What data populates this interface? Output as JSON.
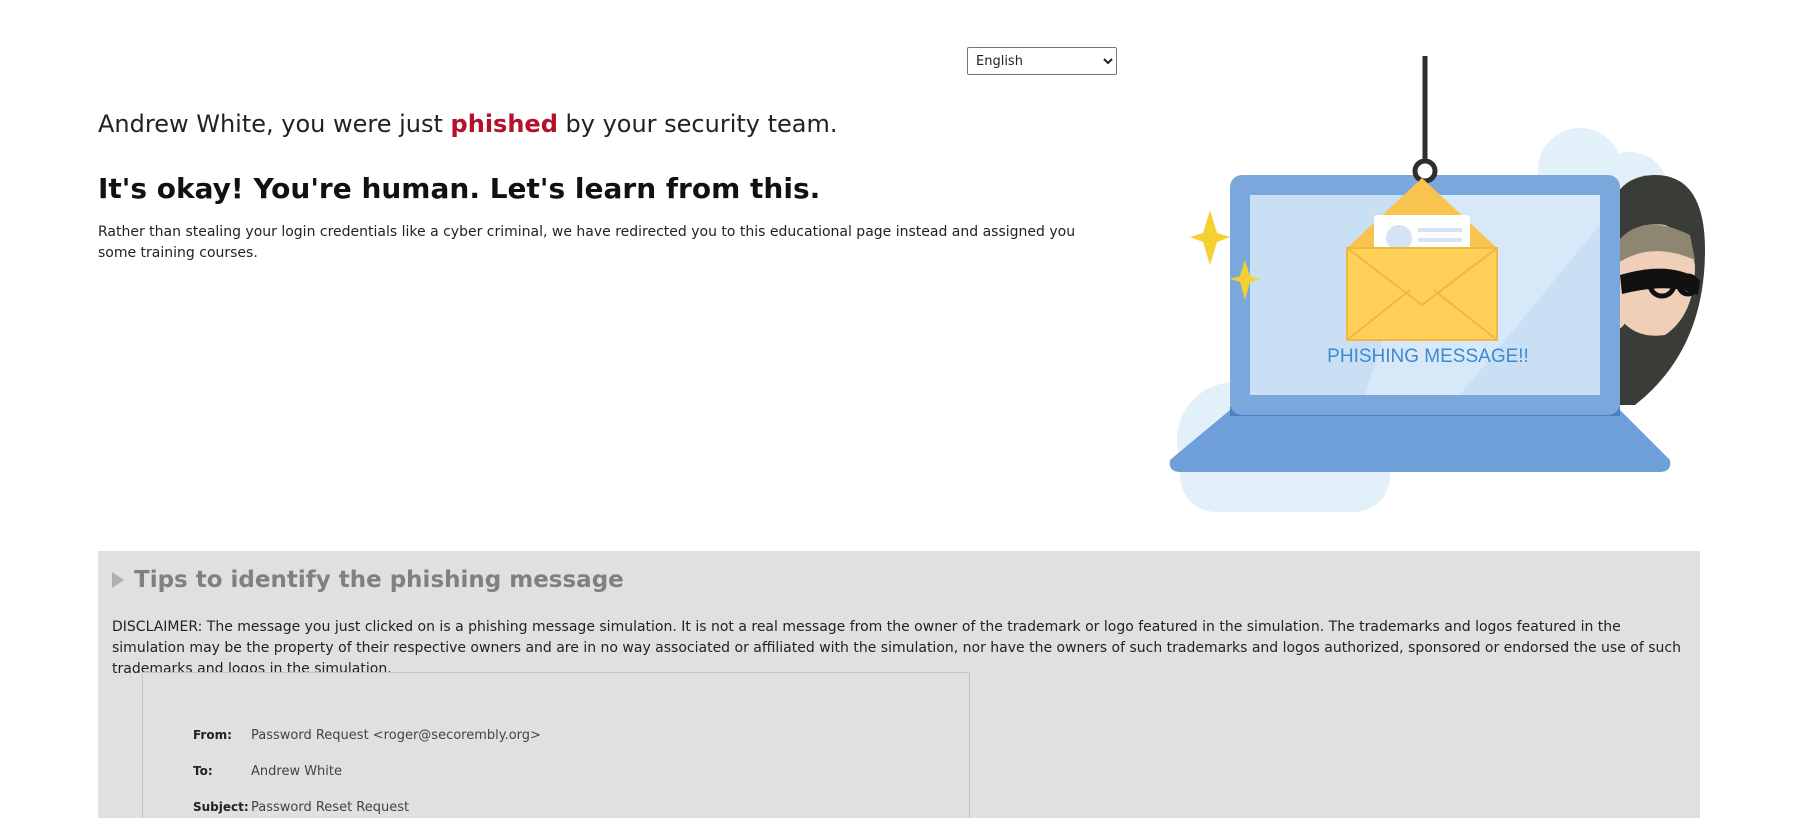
{
  "language": {
    "selected": "English"
  },
  "intro": {
    "before": "Andrew White, you were just ",
    "highlight": "phished",
    "after": " by your security team."
  },
  "headline": "It's okay! You're human. Let's learn from this.",
  "explanation": "Rather than stealing your login credentials like a cyber criminal, we have redirected you to this educational page instead and assigned you some training courses.",
  "illustration": {
    "screen_text": "PHISHING MESSAGE!!"
  },
  "tips": {
    "title": "Tips to identify the phishing message",
    "disclaimer": "DISCLAIMER: The message you just clicked on is a phishing message simulation. It is not a real message from the owner of the trademark or logo featured in the simulation. The trademarks and logos featured in the simulation may be the property of their respective owners and are in no way associated or affiliated with the simulation, nor have the owners of such trademarks and logos authorized, sponsored or endorsed the use of such trademarks and logos in the simulation."
  },
  "message": {
    "from_label": "From:",
    "from_value": "Password Request <roger@secorembly.org>",
    "to_label": "To:",
    "to_value": "Andrew White",
    "subject_label": "Subject:",
    "subject_value": "Password Reset Request"
  },
  "colors": {
    "accent_red": "#b3102a",
    "panel_gray": "#e0e0e0",
    "laptop_blue": "#7aa7dc"
  }
}
